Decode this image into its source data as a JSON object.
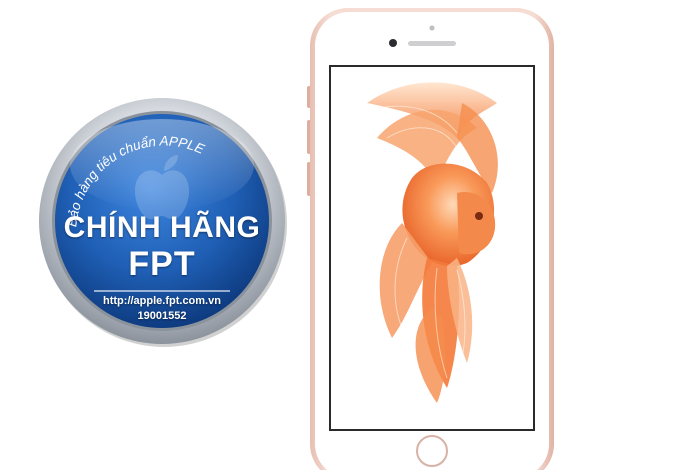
{
  "badge": {
    "arc_text": "Bảo hàng tiêu chuẩn APPLE",
    "title_line_1": "CHÍNH HÃNG",
    "title_line_2": "FPT",
    "url": "http://apple.fpt.com.vn",
    "phone": "19001552"
  },
  "colors": {
    "badge_blue": "#1f5fb5",
    "badge_blue_dark": "#0b3577",
    "badge_ring_silver": "#c9ced6",
    "phone_rose_gold": "#f1cfc4",
    "wallpaper_orange": "#f47a3a"
  },
  "icons": {
    "badge_watermark": "apple-logo-icon",
    "phone_home": "home-button-icon"
  }
}
